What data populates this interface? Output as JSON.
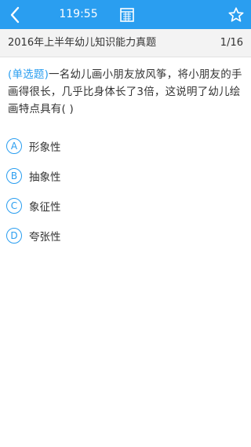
{
  "header": {
    "timer": "119:55",
    "icons": {
      "back": "chevron-left-icon",
      "sheet": "answer-sheet-icon",
      "favorite": "star-icon"
    }
  },
  "subheader": {
    "title": "2016年上半年幼儿知识能力真题",
    "progress": "1/16"
  },
  "question": {
    "type_label": "(单选题)",
    "text": "一名幼儿画小朋友放风筝，将小朋友的手画得很长，几乎比身体长了3倍，这说明了幼儿绘画特点具有(  )"
  },
  "options": [
    {
      "letter": "A",
      "text": "形象性"
    },
    {
      "letter": "B",
      "text": "抽象性"
    },
    {
      "letter": "C",
      "text": "象征性"
    },
    {
      "letter": "D",
      "text": "夸张性"
    }
  ],
  "colors": {
    "accent": "#2a9ef0",
    "text": "#333333",
    "subheader_bg": "#f3f3f3"
  }
}
